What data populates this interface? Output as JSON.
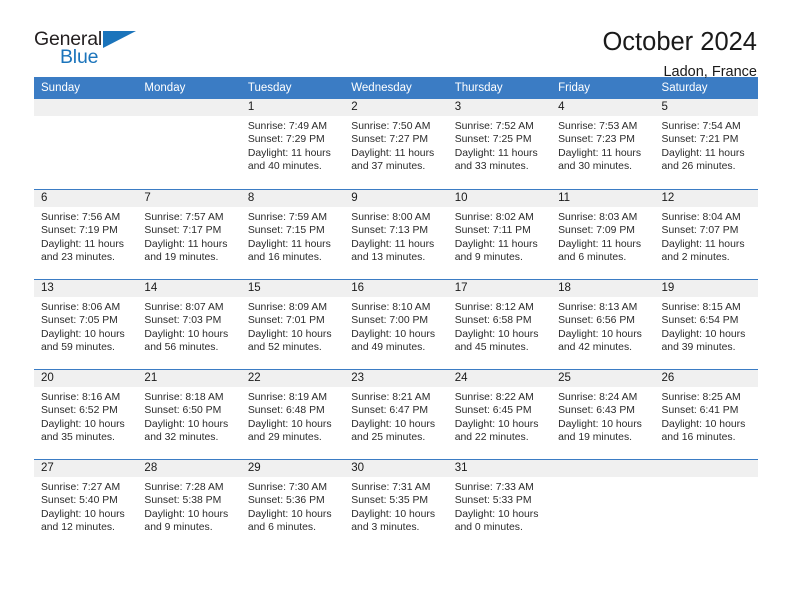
{
  "brand": {
    "name_part1": "General",
    "name_part2": "Blue",
    "triangle_color": "#1b74bb"
  },
  "header": {
    "title": "October 2024",
    "location": "Ladon, France"
  },
  "theme": {
    "header_blue": "#3b7cc4",
    "day_band_gray": "#f0f0f0",
    "text_color": "#1a1a1a"
  },
  "weekdays": [
    "Sunday",
    "Monday",
    "Tuesday",
    "Wednesday",
    "Thursday",
    "Friday",
    "Saturday"
  ],
  "weeks": [
    [
      {
        "day": "",
        "sunrise": "",
        "sunset": "",
        "daylight_line1": "",
        "daylight_line2": ""
      },
      {
        "day": "",
        "sunrise": "",
        "sunset": "",
        "daylight_line1": "",
        "daylight_line2": ""
      },
      {
        "day": "1",
        "sunrise": "Sunrise: 7:49 AM",
        "sunset": "Sunset: 7:29 PM",
        "daylight_line1": "Daylight: 11 hours",
        "daylight_line2": "and 40 minutes."
      },
      {
        "day": "2",
        "sunrise": "Sunrise: 7:50 AM",
        "sunset": "Sunset: 7:27 PM",
        "daylight_line1": "Daylight: 11 hours",
        "daylight_line2": "and 37 minutes."
      },
      {
        "day": "3",
        "sunrise": "Sunrise: 7:52 AM",
        "sunset": "Sunset: 7:25 PM",
        "daylight_line1": "Daylight: 11 hours",
        "daylight_line2": "and 33 minutes."
      },
      {
        "day": "4",
        "sunrise": "Sunrise: 7:53 AM",
        "sunset": "Sunset: 7:23 PM",
        "daylight_line1": "Daylight: 11 hours",
        "daylight_line2": "and 30 minutes."
      },
      {
        "day": "5",
        "sunrise": "Sunrise: 7:54 AM",
        "sunset": "Sunset: 7:21 PM",
        "daylight_line1": "Daylight: 11 hours",
        "daylight_line2": "and 26 minutes."
      }
    ],
    [
      {
        "day": "6",
        "sunrise": "Sunrise: 7:56 AM",
        "sunset": "Sunset: 7:19 PM",
        "daylight_line1": "Daylight: 11 hours",
        "daylight_line2": "and 23 minutes."
      },
      {
        "day": "7",
        "sunrise": "Sunrise: 7:57 AM",
        "sunset": "Sunset: 7:17 PM",
        "daylight_line1": "Daylight: 11 hours",
        "daylight_line2": "and 19 minutes."
      },
      {
        "day": "8",
        "sunrise": "Sunrise: 7:59 AM",
        "sunset": "Sunset: 7:15 PM",
        "daylight_line1": "Daylight: 11 hours",
        "daylight_line2": "and 16 minutes."
      },
      {
        "day": "9",
        "sunrise": "Sunrise: 8:00 AM",
        "sunset": "Sunset: 7:13 PM",
        "daylight_line1": "Daylight: 11 hours",
        "daylight_line2": "and 13 minutes."
      },
      {
        "day": "10",
        "sunrise": "Sunrise: 8:02 AM",
        "sunset": "Sunset: 7:11 PM",
        "daylight_line1": "Daylight: 11 hours",
        "daylight_line2": "and 9 minutes."
      },
      {
        "day": "11",
        "sunrise": "Sunrise: 8:03 AM",
        "sunset": "Sunset: 7:09 PM",
        "daylight_line1": "Daylight: 11 hours",
        "daylight_line2": "and 6 minutes."
      },
      {
        "day": "12",
        "sunrise": "Sunrise: 8:04 AM",
        "sunset": "Sunset: 7:07 PM",
        "daylight_line1": "Daylight: 11 hours",
        "daylight_line2": "and 2 minutes."
      }
    ],
    [
      {
        "day": "13",
        "sunrise": "Sunrise: 8:06 AM",
        "sunset": "Sunset: 7:05 PM",
        "daylight_line1": "Daylight: 10 hours",
        "daylight_line2": "and 59 minutes."
      },
      {
        "day": "14",
        "sunrise": "Sunrise: 8:07 AM",
        "sunset": "Sunset: 7:03 PM",
        "daylight_line1": "Daylight: 10 hours",
        "daylight_line2": "and 56 minutes."
      },
      {
        "day": "15",
        "sunrise": "Sunrise: 8:09 AM",
        "sunset": "Sunset: 7:01 PM",
        "daylight_line1": "Daylight: 10 hours",
        "daylight_line2": "and 52 minutes."
      },
      {
        "day": "16",
        "sunrise": "Sunrise: 8:10 AM",
        "sunset": "Sunset: 7:00 PM",
        "daylight_line1": "Daylight: 10 hours",
        "daylight_line2": "and 49 minutes."
      },
      {
        "day": "17",
        "sunrise": "Sunrise: 8:12 AM",
        "sunset": "Sunset: 6:58 PM",
        "daylight_line1": "Daylight: 10 hours",
        "daylight_line2": "and 45 minutes."
      },
      {
        "day": "18",
        "sunrise": "Sunrise: 8:13 AM",
        "sunset": "Sunset: 6:56 PM",
        "daylight_line1": "Daylight: 10 hours",
        "daylight_line2": "and 42 minutes."
      },
      {
        "day": "19",
        "sunrise": "Sunrise: 8:15 AM",
        "sunset": "Sunset: 6:54 PM",
        "daylight_line1": "Daylight: 10 hours",
        "daylight_line2": "and 39 minutes."
      }
    ],
    [
      {
        "day": "20",
        "sunrise": "Sunrise: 8:16 AM",
        "sunset": "Sunset: 6:52 PM",
        "daylight_line1": "Daylight: 10 hours",
        "daylight_line2": "and 35 minutes."
      },
      {
        "day": "21",
        "sunrise": "Sunrise: 8:18 AM",
        "sunset": "Sunset: 6:50 PM",
        "daylight_line1": "Daylight: 10 hours",
        "daylight_line2": "and 32 minutes."
      },
      {
        "day": "22",
        "sunrise": "Sunrise: 8:19 AM",
        "sunset": "Sunset: 6:48 PM",
        "daylight_line1": "Daylight: 10 hours",
        "daylight_line2": "and 29 minutes."
      },
      {
        "day": "23",
        "sunrise": "Sunrise: 8:21 AM",
        "sunset": "Sunset: 6:47 PM",
        "daylight_line1": "Daylight: 10 hours",
        "daylight_line2": "and 25 minutes."
      },
      {
        "day": "24",
        "sunrise": "Sunrise: 8:22 AM",
        "sunset": "Sunset: 6:45 PM",
        "daylight_line1": "Daylight: 10 hours",
        "daylight_line2": "and 22 minutes."
      },
      {
        "day": "25",
        "sunrise": "Sunrise: 8:24 AM",
        "sunset": "Sunset: 6:43 PM",
        "daylight_line1": "Daylight: 10 hours",
        "daylight_line2": "and 19 minutes."
      },
      {
        "day": "26",
        "sunrise": "Sunrise: 8:25 AM",
        "sunset": "Sunset: 6:41 PM",
        "daylight_line1": "Daylight: 10 hours",
        "daylight_line2": "and 16 minutes."
      }
    ],
    [
      {
        "day": "27",
        "sunrise": "Sunrise: 7:27 AM",
        "sunset": "Sunset: 5:40 PM",
        "daylight_line1": "Daylight: 10 hours",
        "daylight_line2": "and 12 minutes."
      },
      {
        "day": "28",
        "sunrise": "Sunrise: 7:28 AM",
        "sunset": "Sunset: 5:38 PM",
        "daylight_line1": "Daylight: 10 hours",
        "daylight_line2": "and 9 minutes."
      },
      {
        "day": "29",
        "sunrise": "Sunrise: 7:30 AM",
        "sunset": "Sunset: 5:36 PM",
        "daylight_line1": "Daylight: 10 hours",
        "daylight_line2": "and 6 minutes."
      },
      {
        "day": "30",
        "sunrise": "Sunrise: 7:31 AM",
        "sunset": "Sunset: 5:35 PM",
        "daylight_line1": "Daylight: 10 hours",
        "daylight_line2": "and 3 minutes."
      },
      {
        "day": "31",
        "sunrise": "Sunrise: 7:33 AM",
        "sunset": "Sunset: 5:33 PM",
        "daylight_line1": "Daylight: 10 hours",
        "daylight_line2": "and 0 minutes."
      },
      {
        "day": "",
        "sunrise": "",
        "sunset": "",
        "daylight_line1": "",
        "daylight_line2": ""
      },
      {
        "day": "",
        "sunrise": "",
        "sunset": "",
        "daylight_line1": "",
        "daylight_line2": ""
      }
    ]
  ]
}
